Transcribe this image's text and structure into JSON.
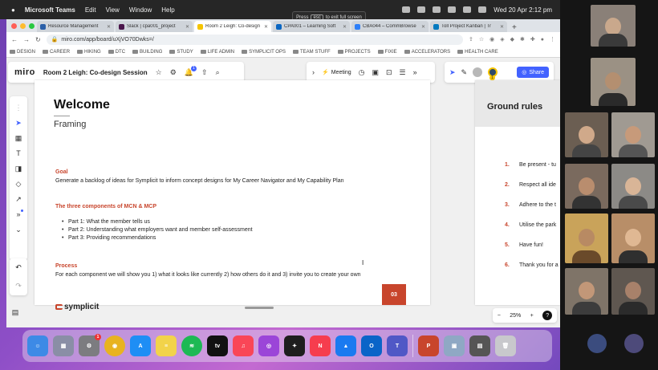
{
  "menubar": {
    "app": "Microsoft Teams",
    "items": [
      "Edit",
      "View",
      "Window",
      "Help"
    ],
    "clock": "Wed 20 Apr  2:12 pm"
  },
  "fullscreen_hint": {
    "press": "Press",
    "key": "esc",
    "rest": "to exit full screen"
  },
  "tabs": [
    {
      "title": "Resource Management",
      "color": "#2a5fa8"
    },
    {
      "title": "Slack | cpa001_project",
      "color": "#4a154b"
    },
    {
      "title": "Room 2 Leigh: Co-design",
      "color": "#f5c400"
    },
    {
      "title": "CPA001 – Learning Soft",
      "color": "#0a66c2"
    },
    {
      "title": "CBA044 – CommBrowse",
      "color": "#2d7ff9"
    },
    {
      "title": "Toll Project Kanban | Tr",
      "color": "#0079bf"
    }
  ],
  "address": {
    "url": "miro.com/app/board/uXjVO70Dwks=/"
  },
  "bookmarks": [
    "DESIGN",
    "CAREER",
    "HIKING",
    "DTC",
    "BUILDING",
    "STUDY",
    "LIFE ADMIN",
    "SYMPLICIT OPS",
    "TEAM STUFF",
    "PROJECTS",
    "FIXIE",
    "ACCELERATORS",
    "HEALTH CARE"
  ],
  "miro": {
    "logo": "miro",
    "board_title": "Room 2 Leigh: Co-design Session",
    "meeting_label": "Meeting",
    "share_label": "Share",
    "avatar_count": "1",
    "notif_count": "1",
    "zoom_level": "25%",
    "help": "?"
  },
  "frame": {
    "title": "Welcome",
    "subtitle": "Framing",
    "goal_heading": "Goal",
    "goal_text": "Generate a backlog of ideas for Symplicit to inform concept designs for My Career Navigator and My Capability Plan",
    "components_heading": "The three components of MCN & MCP",
    "bullets": [
      "Part 1: What the member tells us",
      "Part 2: Understanding what employers want and member self-assessment",
      "Part 3: Providing recommendations"
    ],
    "process_heading": "Process",
    "process_text": "For each component we will show you 1) what it looks like currently 2) how others do it and 3) invite you to create your own",
    "brand": "symplicit",
    "page_number": "03"
  },
  "ground_rules": {
    "title": "Ground rules",
    "items": [
      {
        "num": "1.",
        "text": "Be present - tu"
      },
      {
        "num": "2.",
        "text": "Respect all ide"
      },
      {
        "num": "3.",
        "text": "Adhere to the t"
      },
      {
        "num": "4.",
        "text": "Utilise the park"
      },
      {
        "num": "5.",
        "text": "Have fun!"
      },
      {
        "num": "6.",
        "text": "Thank you for a"
      }
    ]
  },
  "dock": {
    "settings_badge": "1",
    "tv_label": "tv",
    "apps": [
      {
        "name": "finder",
        "color": "#3d8ae6"
      },
      {
        "name": "launchpad",
        "color": "#8a8ea6"
      },
      {
        "name": "settings",
        "color": "#7c7c80"
      },
      {
        "name": "chrome",
        "color": "#e8b320"
      },
      {
        "name": "app-store",
        "color": "#1e8ef5"
      },
      {
        "name": "notes",
        "color": "#f2d34a"
      },
      {
        "name": "spotify",
        "color": "#1db954"
      },
      {
        "name": "apple-tv",
        "color": "#111111"
      },
      {
        "name": "music",
        "color": "#f94657"
      },
      {
        "name": "podcasts",
        "color": "#9b45d8"
      },
      {
        "name": "figma",
        "color": "#1e1e1e"
      },
      {
        "name": "news",
        "color": "#f63d4e"
      },
      {
        "name": "keynote",
        "color": "#1a7af0"
      },
      {
        "name": "outlook",
        "color": "#0a64c8"
      },
      {
        "name": "teams",
        "color": "#5058c6"
      },
      {
        "name": "powerpoint",
        "color": "#c8452c"
      },
      {
        "name": "preview",
        "color": "#8fa8c4"
      },
      {
        "name": "screens",
        "color": "#555555"
      },
      {
        "name": "trash",
        "color": "#c8c8cc"
      }
    ]
  },
  "colors": {
    "accent": "#c8452c",
    "miro_blue": "#4262ff"
  }
}
